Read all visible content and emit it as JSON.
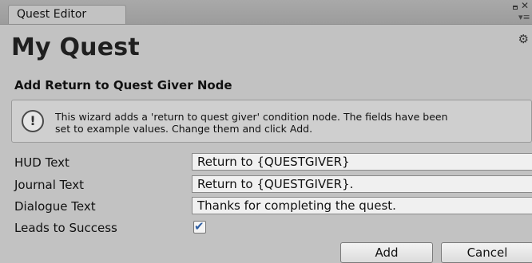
{
  "window": {
    "tab_label": "Quest Editor",
    "maximize_icon": "maximize-icon",
    "close_icon": "close-icon",
    "menu_icon": "context-menu-icon"
  },
  "header": {
    "title": "My Quest",
    "gear_icon": "gear-icon"
  },
  "section": {
    "title": "Add Return to Quest Giver Node"
  },
  "help": {
    "icon": "info-icon",
    "glyph": "!",
    "text": "This wizard adds a 'return to quest giver' condition node. The fields have been\nset to example values. Change them and click Add."
  },
  "fields": {
    "hud_text": {
      "label": "HUD Text",
      "value": "Return to {QUESTGIVER}"
    },
    "journal_text": {
      "label": "Journal Text",
      "value": "Return to {QUESTGIVER}."
    },
    "dialogue_text": {
      "label": "Dialogue Text",
      "value": "Thanks for completing the quest."
    },
    "leads_to_success": {
      "label": "Leads to Success",
      "checked": true,
      "check_glyph": "✔"
    }
  },
  "buttons": {
    "add": "Add",
    "cancel": "Cancel"
  },
  "colors": {
    "panel_bg": "#c2c2c2",
    "field_bg": "#f0f0f0",
    "check_color": "#2f5fa3"
  }
}
